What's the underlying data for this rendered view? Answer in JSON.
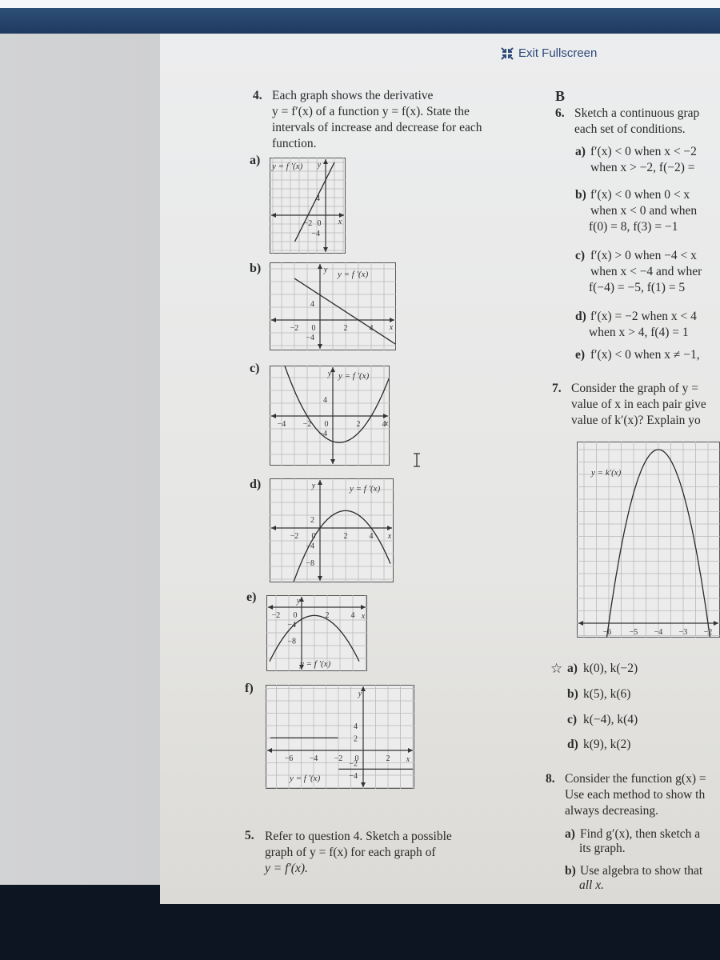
{
  "toolbar": {
    "exit_fullscreen_label": "Exit Fullscreen",
    "exit_fullscreen_icon": "compress-arrows-icon"
  },
  "q4": {
    "number": "4.",
    "lines": [
      "Each graph shows the derivative",
      "y = f′(x) of a function y = f(x). State the",
      "intervals of increase and decrease for each",
      "function."
    ],
    "parts": [
      {
        "label": "a)",
        "curve_label": "y = f ′(x)",
        "x_ticks": [
          "−2",
          "0"
        ],
        "y_ticks": [
          "4",
          "−4"
        ],
        "axis_x": "x",
        "axis_y": "y"
      },
      {
        "label": "b)",
        "curve_label": "y = f ′(x)",
        "x_ticks": [
          "−2",
          "0",
          "2",
          "4"
        ],
        "y_ticks": [
          "4",
          "−4"
        ],
        "axis_x": "x",
        "axis_y": "y"
      },
      {
        "label": "c)",
        "curve_label": "y = f ′(x)",
        "x_ticks": [
          "−4",
          "−2",
          "0",
          "2",
          "4"
        ],
        "y_ticks": [
          "4",
          "−4"
        ],
        "axis_x": "x",
        "axis_y": "y"
      },
      {
        "label": "d)",
        "curve_label": "y = f ′(x)",
        "x_ticks": [
          "−2",
          "0",
          "2",
          "4"
        ],
        "y_ticks": [
          "2",
          "−4",
          "−8"
        ],
        "axis_x": "x",
        "axis_y": "y"
      },
      {
        "label": "e)",
        "curve_label": "y = f ′(x)",
        "x_ticks": [
          "−2",
          "0",
          "2",
          "4"
        ],
        "y_ticks": [
          "−4",
          "−8"
        ],
        "axis_x": "x",
        "axis_y": "y"
      },
      {
        "label": "f)",
        "curve_label": "y = f ′(x)",
        "x_ticks": [
          "−6",
          "−4",
          "−2",
          "0",
          "2"
        ],
        "y_ticks": [
          "4",
          "2",
          "−2",
          "−4"
        ],
        "axis_x": "x",
        "axis_y": "y"
      }
    ]
  },
  "q5": {
    "number": "5.",
    "lines": [
      "Refer to question 4. Sketch a possible",
      "graph of y = f(x) for each graph of",
      "y = f′(x)."
    ]
  },
  "section": "B",
  "q6": {
    "number": "6.",
    "lines": [
      "Sketch a continuous grap",
      "each set of conditions."
    ],
    "parts": [
      {
        "label": "a)",
        "lines": [
          "f′(x) < 0 when x < −2",
          "when x > −2, f(−2) ="
        ]
      },
      {
        "label": "b)",
        "lines": [
          "f′(x) < 0 when 0 < x",
          "when x < 0 and when",
          "f(0) = 8, f(3) = −1"
        ]
      },
      {
        "label": "c)",
        "lines": [
          "f′(x) > 0 when −4 < x",
          "when x < −4 and wher",
          "f(−4) = −5, f(1) = 5"
        ]
      },
      {
        "label": "d)",
        "lines": [
          "f′(x) = −2 when x < 4",
          "when x > 4, f(4) = 1"
        ]
      },
      {
        "label": "e)",
        "lines": [
          "f′(x) < 0 when x ≠ −1,"
        ]
      }
    ]
  },
  "q7": {
    "number": "7.",
    "lines": [
      "Consider the graph of y =",
      "value of x in each pair give",
      "value of k′(x)? Explain yo"
    ],
    "graph": {
      "curve_label": "y = k′(x)",
      "x_ticks": [
        "−6",
        "−5",
        "−4",
        "−3",
        "−2"
      ]
    },
    "parts": [
      {
        "label": "a)",
        "text": "k(0), k(−2)",
        "starred": true
      },
      {
        "label": "b)",
        "text": "k(5), k(6)"
      },
      {
        "label": "c)",
        "text": "k(−4), k(4)"
      },
      {
        "label": "d)",
        "text": "k(9), k(2)"
      }
    ]
  },
  "q8": {
    "number": "8.",
    "lines": [
      "Consider the function g(x) =",
      "Use each method to show th",
      "always decreasing."
    ],
    "parts": [
      {
        "label": "a)",
        "lines": [
          "Find g′(x), then sketch a",
          "its graph."
        ]
      },
      {
        "label": "b)",
        "lines": [
          "Use algebra to show that",
          "all x."
        ]
      }
    ]
  },
  "colors": {
    "bezel": "#1f3a5e",
    "accent": "#2d4a7a",
    "page": "#e9e9e8",
    "ink": "#2a2a2a"
  },
  "chart_data": [
    {
      "type": "line",
      "title": "4a) y = f′(x)",
      "x": [
        -3,
        0.5
      ],
      "y": [
        -6,
        7
      ],
      "description": "line through (−2,0), slope ≈ 4",
      "xlim": [
        -3.5,
        2
      ],
      "ylim": [
        -6,
        7
      ]
    },
    {
      "type": "line",
      "title": "4b) y = f′(x)",
      "x": [
        -0.5,
        6
      ],
      "y": [
        6.5,
        -6
      ],
      "description": "line through (0,6) and (3,0), slope −2",
      "xlim": [
        -3.5,
        6
      ],
      "ylim": [
        -6,
        7
      ]
    },
    {
      "type": "line",
      "title": "4c) y = f′(x)",
      "description": "upward parabola, zeros at x=−2 and x=3, vertex ≈ (0.5,−6.25)",
      "xlim": [
        -4.5,
        4.5
      ],
      "ylim": [
        -7,
        8
      ]
    },
    {
      "type": "line",
      "title": "4d) y = f′(x)",
      "description": "downward parabola, zeros at x=0 and x=4, vertex (2,4)",
      "xlim": [
        -3,
        5.5
      ],
      "ylim": [
        -10,
        6
      ]
    },
    {
      "type": "line",
      "title": "4e) y = f′(x)",
      "description": "downward parabola, vertex ≈ (1,−2), below x-axis",
      "xlim": [
        -2.5,
        4.5
      ],
      "ylim": [
        -10,
        1
      ]
    },
    {
      "type": "line",
      "title": "4f) y = f′(x)",
      "description": "step: y = 2 for x < −2, y = −3 for x > −2",
      "xlim": [
        -7,
        3.5
      ],
      "ylim": [
        -5,
        5
      ]
    },
    {
      "type": "line",
      "title": "7) y = k′(x)",
      "description": "downward parabola, zeros at x=−6 and x=−2, vertex at x=−4",
      "x_ticks": [
        "−6",
        "−5",
        "−4",
        "−3",
        "−2"
      ]
    }
  ]
}
